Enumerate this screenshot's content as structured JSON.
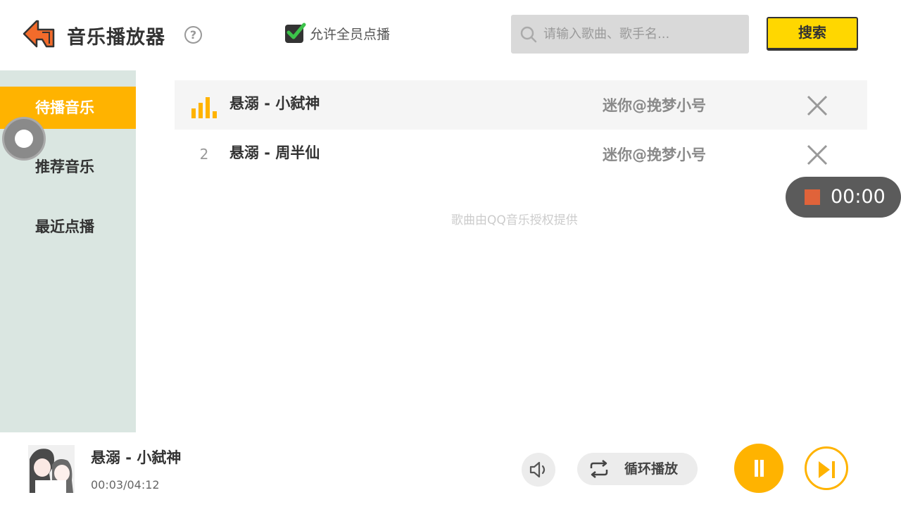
{
  "header": {
    "app_title": "音乐播放器",
    "help_symbol": "?",
    "allow_all_label": "允许全员点播",
    "allow_all_checked": true,
    "search_placeholder": "请输入歌曲、歌手名...",
    "search_button": "搜索"
  },
  "sidebar": {
    "items": [
      {
        "label": "待播音乐",
        "active": true
      },
      {
        "label": "推荐音乐",
        "active": false
      },
      {
        "label": "最近点播",
        "active": false
      }
    ]
  },
  "playlist": {
    "rows": [
      {
        "index": "",
        "playing": true,
        "title": "悬溺 - 小弑神",
        "requested_by": "迷你@挽梦小号"
      },
      {
        "index": "2",
        "playing": false,
        "title": "悬溺 - 周半仙",
        "requested_by": "迷你@挽梦小号"
      }
    ],
    "copyright_note": "歌曲由QQ音乐授权提供"
  },
  "recorder": {
    "time": "00:00"
  },
  "player": {
    "now_playing_title": "悬溺 - 小弑神",
    "progress": "00:03/04:12",
    "loop_mode_label": "循环播放"
  },
  "icons": {
    "logo": "back-arrow-logo-icon",
    "help": "question-circle-icon",
    "checkbox": "checkmark-icon",
    "search": "search-icon",
    "playing": "equalizer-bars-icon",
    "remove": "close-icon",
    "stop": "stop-square-icon",
    "volume": "speaker-icon",
    "loop": "repeat-icon",
    "pause": "pause-icon",
    "next": "skip-next-icon"
  },
  "colors": {
    "accent": "#ffb300",
    "search_button": "#ffd700",
    "sidebar_bg": "#dae6e1",
    "logo": "#f26b2b",
    "recorder_bg": "#5b5b5b",
    "recorder_stop": "#e0633a"
  }
}
